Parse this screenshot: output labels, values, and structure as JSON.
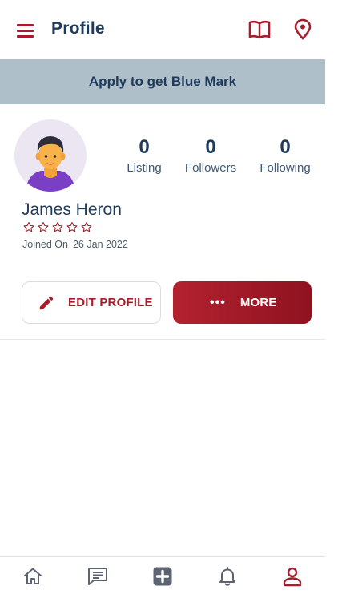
{
  "header": {
    "title": "Profile",
    "icons": [
      "menu-icon",
      "book-icon",
      "location-pin-icon"
    ]
  },
  "banner": {
    "text": "Apply to get Blue Mark"
  },
  "profile": {
    "name": "James Heron",
    "rating": 0,
    "rating_max": 5,
    "joined_label": "Joined On",
    "joined_date": "26 Jan 2022",
    "stats": [
      {
        "value": "0",
        "label": "Listing"
      },
      {
        "value": "0",
        "label": "Followers"
      },
      {
        "value": "0",
        "label": "Following"
      }
    ]
  },
  "actions": {
    "edit_label": "EDIT PROFILE",
    "more_dots": "•••",
    "more_label": "MORE"
  },
  "bottom_nav": {
    "items": [
      "home-icon",
      "chat-icon",
      "add-icon",
      "bell-icon",
      "user-icon"
    ],
    "active": "user-icon"
  },
  "colors": {
    "accent": "#a51d2b",
    "text": "#1f3a5a",
    "banner_bg": "#aebfca",
    "avatar_bg": "#ece6f3"
  }
}
